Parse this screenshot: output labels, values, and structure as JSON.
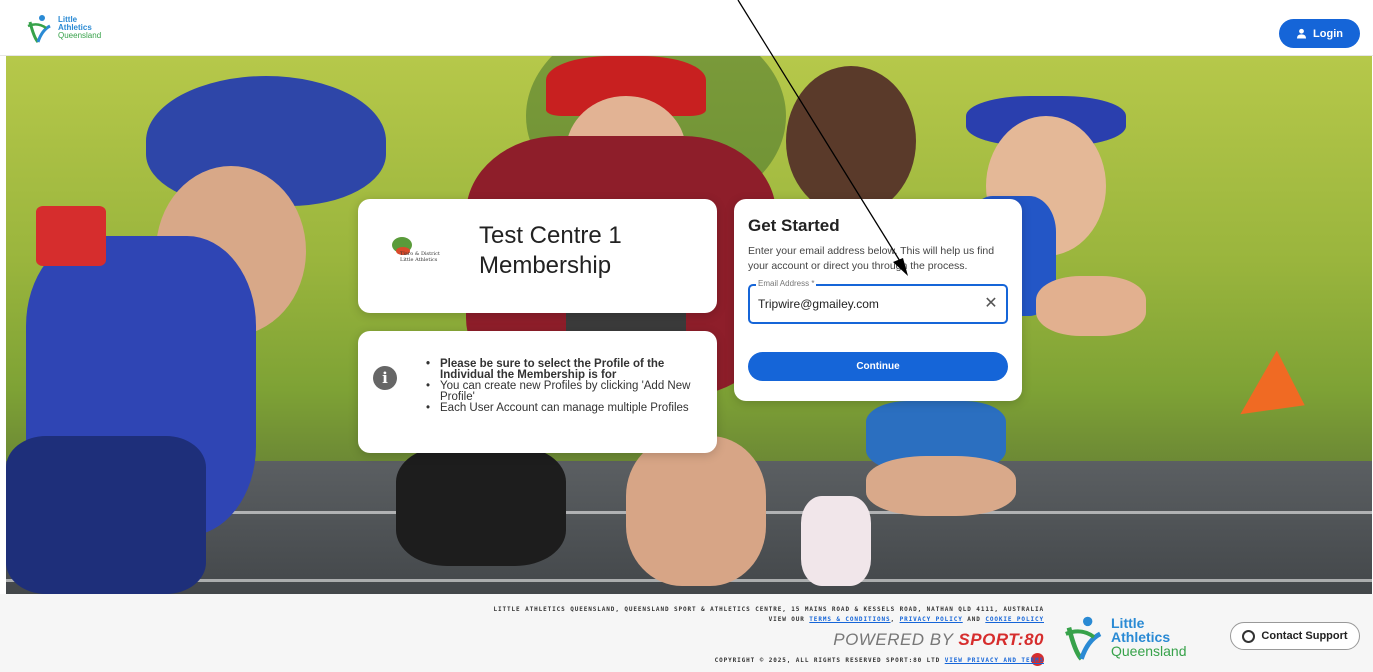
{
  "header": {
    "logo": {
      "line1": "Little",
      "line2": "Athletics",
      "line3": "Queensland"
    },
    "login_label": "Login"
  },
  "title_card": {
    "club_logo_text": "Tiaro & District Little Athletics",
    "title_line1": "Test Centre 1",
    "title_line2": "Membership"
  },
  "info_card": {
    "items": [
      "Please be sure to select the Profile of the Individual the Membership is for",
      "You can create new Profiles by clicking 'Add New Profile'",
      "Each User Account can manage multiple Profiles"
    ]
  },
  "get_started": {
    "title": "Get Started",
    "description": "Enter your email address below. This will help us find your account or direct you through the process.",
    "email_label": "Email Address *",
    "email_value": "Tripwire@gmailey.com",
    "continue_label": "Continue"
  },
  "footer": {
    "address": "LITTLE ATHLETICS QUEENSLAND, QUEENSLAND SPORT & ATHLETICS CENTRE, 15 MAINS ROAD & KESSELS ROAD, NATHAN QLD 4111, AUSTRALIA",
    "view_our": "VIEW OUR",
    "terms_link": "TERMS & CONDITIONS",
    "privacy_link": "PRIVACY POLICY",
    "and": "AND",
    "cookie_link": "COOKIE POLICY",
    "powered_prefix": "POWERED BY",
    "powered_brand": "SPORT:80",
    "copyright": "COPYRIGHT © 2025, ALL RIGHTS RESERVED SPORT:80 LTD",
    "privacy_terms_link": "VIEW PRIVACY AND TERMS",
    "logo": {
      "line1": "Little",
      "line2": "Athletics",
      "line3": "Queensland"
    },
    "support_label": "Contact Support"
  },
  "colors": {
    "primary": "#1565d8",
    "brand_blue": "#2a8ad4",
    "brand_green": "#37a24a"
  }
}
